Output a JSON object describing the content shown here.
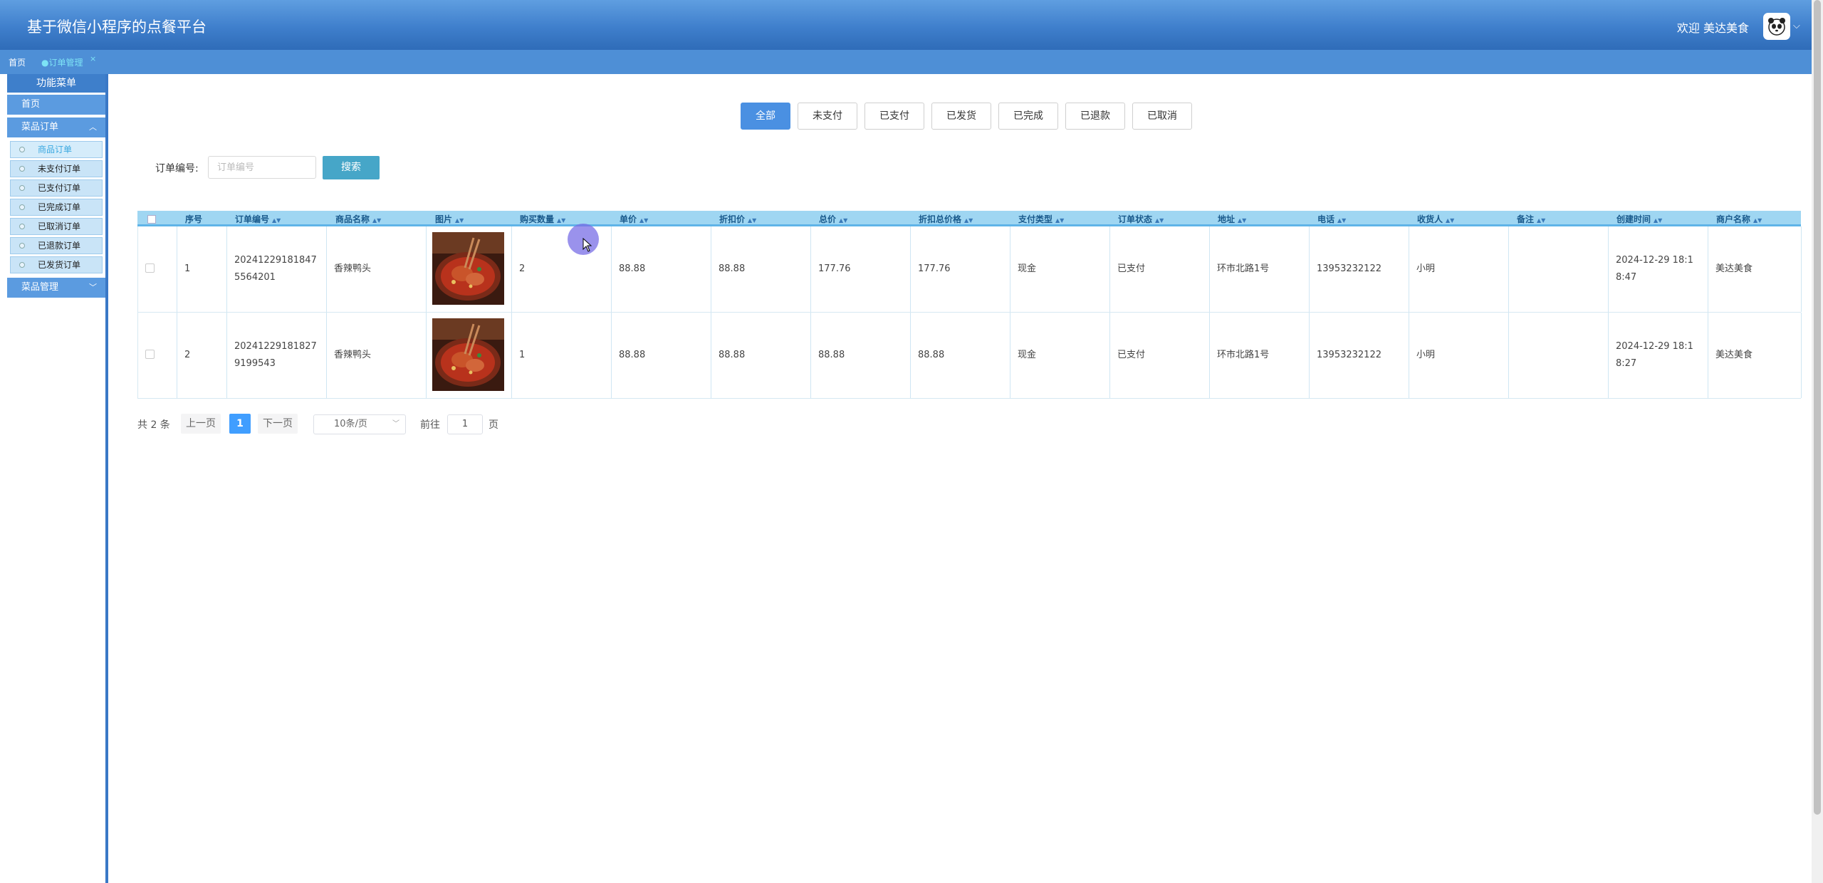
{
  "header": {
    "app_title": "基于微信小程序的点餐平台",
    "welcome": "欢迎 美达美食"
  },
  "tabs": {
    "home": "首页",
    "active": "●订单管理",
    "close": "×"
  },
  "sidebar": {
    "title": "功能菜单",
    "home": "首页",
    "orders_group": "菜品订单",
    "order_items": [
      "商品订单",
      "未支付订单",
      "已支付订单",
      "已完成订单",
      "已取消订单",
      "已退款订单",
      "已发货订单"
    ],
    "dishes_group": "菜品管理"
  },
  "filters": [
    "全部",
    "未支付",
    "已支付",
    "已发货",
    "已完成",
    "已退款",
    "已取消"
  ],
  "search": {
    "label": "订单编号:",
    "placeholder": "订单编号",
    "button": "搜索"
  },
  "table": {
    "columns": [
      "序号",
      "订单编号",
      "商品名称",
      "图片",
      "购买数量",
      "单价",
      "折扣价",
      "总价",
      "折扣总价格",
      "支付类型",
      "订单状态",
      "地址",
      "电话",
      "收货人",
      "备注",
      "创建时间",
      "商户名称"
    ],
    "rows": [
      [
        "1",
        "202412291818475564201",
        "香辣鸭头",
        "",
        "2",
        "88.88",
        "88.88",
        "177.76",
        "177.76",
        "现金",
        "已支付",
        "环市北路1号",
        "13953232122",
        "小明",
        "",
        "2024-12-29 18:18:47",
        "美达美食"
      ],
      [
        "2",
        "202412291818279199543",
        "香辣鸭头",
        "",
        "1",
        "88.88",
        "88.88",
        "88.88",
        "88.88",
        "现金",
        "已支付",
        "环市北路1号",
        "13953232122",
        "小明",
        "",
        "2024-12-29 18:18:27",
        "美达美食"
      ]
    ]
  },
  "pagination": {
    "total": "共 2 条",
    "prev": "上一页",
    "current": "1",
    "next": "下一页",
    "page_size": "10条/页",
    "goto": "前往",
    "goto_value": "1",
    "page_suffix": "页"
  },
  "colors": {
    "header": "#3f7fcc",
    "accent": "#4a90e2",
    "table_header": "#9fd6f2"
  }
}
